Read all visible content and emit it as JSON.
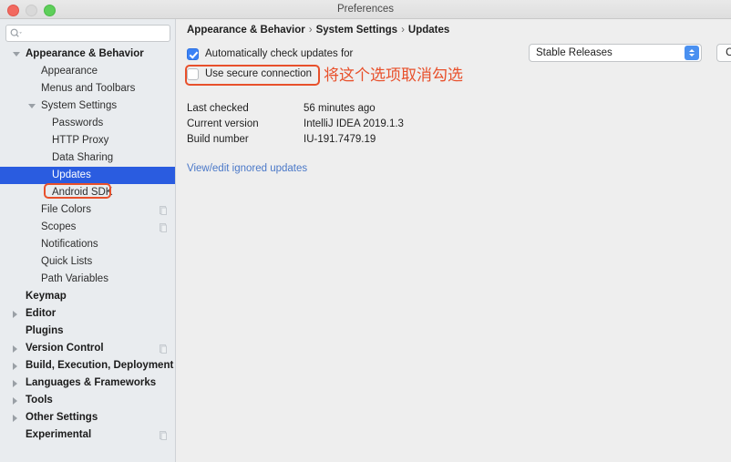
{
  "window": {
    "title": "Preferences",
    "controls": [
      "close",
      "minimize",
      "zoom"
    ]
  },
  "sidebar": {
    "search": {
      "value": "",
      "placeholder": ""
    },
    "items": [
      {
        "label": "Appearance & Behavior",
        "indent": 0,
        "bold": true,
        "twisty": "down",
        "selected": false,
        "doc": false
      },
      {
        "label": "Appearance",
        "indent": 1,
        "bold": false,
        "twisty": "none",
        "selected": false,
        "doc": false
      },
      {
        "label": "Menus and Toolbars",
        "indent": 1,
        "bold": false,
        "twisty": "none",
        "selected": false,
        "doc": false
      },
      {
        "label": "System Settings",
        "indent": 1,
        "bold": false,
        "twisty": "down1",
        "selected": false,
        "doc": false
      },
      {
        "label": "Passwords",
        "indent": 2,
        "bold": false,
        "twisty": "none",
        "selected": false,
        "doc": false
      },
      {
        "label": "HTTP Proxy",
        "indent": 2,
        "bold": false,
        "twisty": "none",
        "selected": false,
        "doc": false
      },
      {
        "label": "Data Sharing",
        "indent": 2,
        "bold": false,
        "twisty": "none",
        "selected": false,
        "doc": false
      },
      {
        "label": "Updates",
        "indent": 2,
        "bold": false,
        "twisty": "none",
        "selected": true,
        "doc": false
      },
      {
        "label": "Android SDK",
        "indent": 2,
        "bold": false,
        "twisty": "none",
        "selected": false,
        "doc": false
      },
      {
        "label": "File Colors",
        "indent": 1,
        "bold": false,
        "twisty": "none",
        "selected": false,
        "doc": true
      },
      {
        "label": "Scopes",
        "indent": 1,
        "bold": false,
        "twisty": "none",
        "selected": false,
        "doc": true
      },
      {
        "label": "Notifications",
        "indent": 1,
        "bold": false,
        "twisty": "none",
        "selected": false,
        "doc": false
      },
      {
        "label": "Quick Lists",
        "indent": 1,
        "bold": false,
        "twisty": "none",
        "selected": false,
        "doc": false
      },
      {
        "label": "Path Variables",
        "indent": 1,
        "bold": false,
        "twisty": "none",
        "selected": false,
        "doc": false
      },
      {
        "label": "Keymap",
        "indent": 0,
        "bold": true,
        "twisty": "none",
        "selected": false,
        "doc": false
      },
      {
        "label": "Editor",
        "indent": 0,
        "bold": true,
        "twisty": "right",
        "selected": false,
        "doc": false
      },
      {
        "label": "Plugins",
        "indent": 0,
        "bold": true,
        "twisty": "none",
        "selected": false,
        "doc": false
      },
      {
        "label": "Version Control",
        "indent": 0,
        "bold": true,
        "twisty": "right",
        "selected": false,
        "doc": true
      },
      {
        "label": "Build, Execution, Deployment",
        "indent": 0,
        "bold": true,
        "twisty": "right",
        "selected": false,
        "doc": false
      },
      {
        "label": "Languages & Frameworks",
        "indent": 0,
        "bold": true,
        "twisty": "right",
        "selected": false,
        "doc": false
      },
      {
        "label": "Tools",
        "indent": 0,
        "bold": true,
        "twisty": "right",
        "selected": false,
        "doc": false
      },
      {
        "label": "Other Settings",
        "indent": 0,
        "bold": true,
        "twisty": "right",
        "selected": false,
        "doc": false
      },
      {
        "label": "Experimental",
        "indent": 0,
        "bold": true,
        "twisty": "none",
        "selected": false,
        "doc": true
      }
    ]
  },
  "main": {
    "breadcrumb": [
      "Appearance & Behavior",
      "System Settings",
      "Updates"
    ],
    "breadcrumb_separator": "›",
    "auto_check": {
      "label": "Automatically check updates for",
      "checked": true,
      "channel": "Stable Releases",
      "check_now_label": "Check Now"
    },
    "secure_connection": {
      "label": "Use secure connection",
      "checked": false
    },
    "info_rows": [
      {
        "key": "Last checked",
        "value": "56 minutes ago"
      },
      {
        "key": "Current version",
        "value": "IntelliJ IDEA 2019.1.3"
      },
      {
        "key": "Build number",
        "value": "IU-191.7479.19"
      }
    ],
    "ignored_updates_link": "View/edit ignored updates"
  },
  "annotations": {
    "note_text": "将这个选项取消勾选",
    "accent_color": "#e8502b",
    "selection_color": "#2a5ce0"
  }
}
